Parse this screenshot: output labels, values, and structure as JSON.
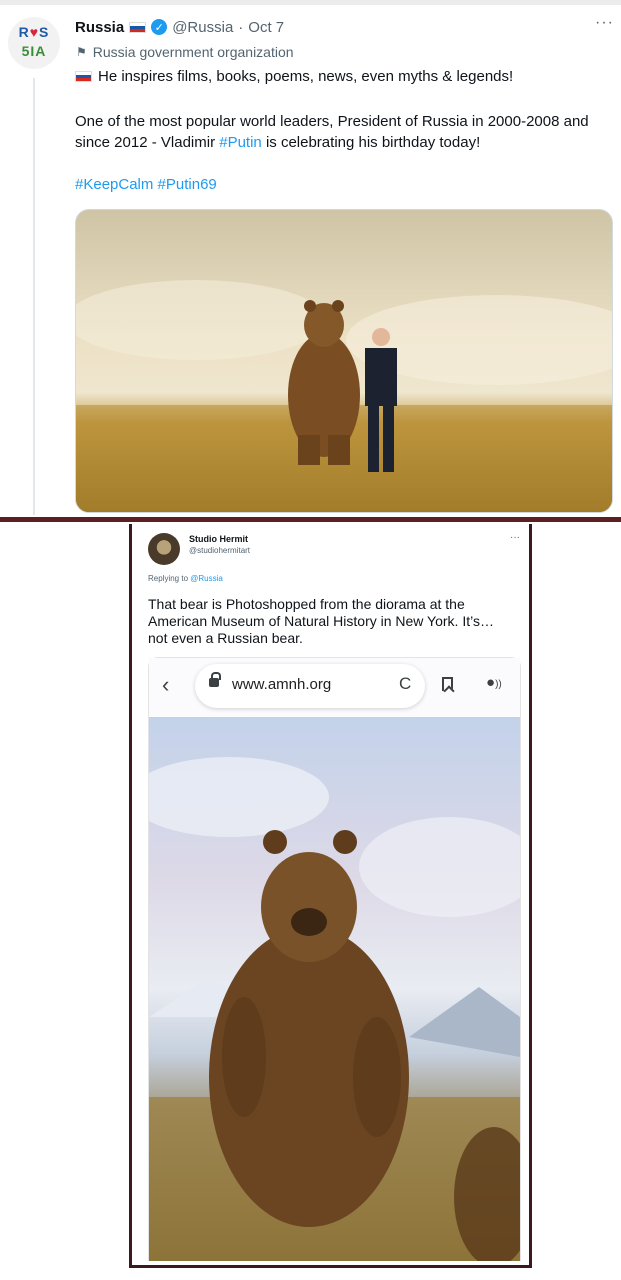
{
  "tweet": {
    "avatar": {
      "line1": [
        "R",
        "♥",
        "S"
      ],
      "line2": [
        "5",
        "I",
        "A"
      ]
    },
    "name": "Russia",
    "handle": "@Russia",
    "date": "Oct 7",
    "more": "···",
    "label": "Russia government organization",
    "bio_line": "He inspires films, books, poems, news, even myths & legends!",
    "body_before": "One of the most popular world leaders, President of Russia in 2000-2008 and since 2012 - Vladimir ",
    "body_tag": "#Putin",
    "body_after": " is celebrating his birthday today!",
    "hashtags": "#KeepCalm #Putin69",
    "flag_colors": [
      "#ffffff",
      "#1c57a7",
      "#d52b1e"
    ],
    "verified_color": "#1d9bf0"
  },
  "reply": {
    "name": "Studio Hermit",
    "handle": "@studiohermitart",
    "more": "···",
    "replying_prefix": "Replying to ",
    "replying_to": "@Russia",
    "body": "That bear is Photoshopped from the diorama at the American Museum of Natural History in New York. It’s… not even a Russian bear.",
    "browser": {
      "url": "www.amnh.org",
      "back_icon": "‹",
      "reload_icon": "C",
      "person_icon": "●"
    }
  }
}
